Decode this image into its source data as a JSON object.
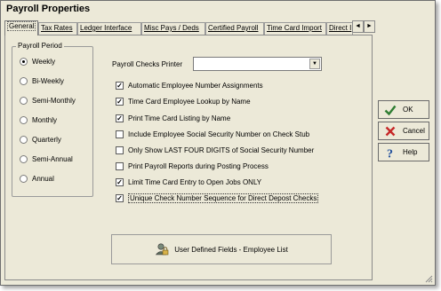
{
  "window": {
    "title": "Payroll Properties"
  },
  "tabs": [
    {
      "label": "General",
      "active": true
    },
    {
      "label": "Tax Rates",
      "active": false
    },
    {
      "label": "Ledger Interface",
      "active": false
    },
    {
      "label": "Misc Pays / Deds",
      "active": false
    },
    {
      "label": "Certified Payroll",
      "active": false
    },
    {
      "label": "Time Card Import",
      "active": false
    },
    {
      "label": "Direct I",
      "active": false
    }
  ],
  "tab_scroll": {
    "left": "◄",
    "right": "►"
  },
  "payroll_period": {
    "legend": "Payroll Period",
    "options": [
      {
        "label": "Weekly",
        "selected": true
      },
      {
        "label": "Bi-Weekly",
        "selected": false
      },
      {
        "label": "Semi-Monthly",
        "selected": false
      },
      {
        "label": "Monthly",
        "selected": false
      },
      {
        "label": "Quarterly",
        "selected": false
      },
      {
        "label": "Semi-Annual",
        "selected": false
      },
      {
        "label": "Annual",
        "selected": false
      }
    ]
  },
  "printer": {
    "label": "Payroll Checks Printer",
    "value": ""
  },
  "options": [
    {
      "label": "Automatic Employee Number Assignments",
      "checked": true
    },
    {
      "label": "Time Card Employee Lookup by Name",
      "checked": true
    },
    {
      "label": "Print Time Card Listing by Name",
      "checked": true
    },
    {
      "label": "Include Employee Social Security Number on Check Stub",
      "checked": false
    },
    {
      "label": "Only Show LAST FOUR DIGITS of Social Security Number",
      "checked": false
    },
    {
      "label": "Print Payroll Reports during Posting Process",
      "checked": false
    },
    {
      "label": "Limit Time Card Entry to Open Jobs ONLY",
      "checked": true
    },
    {
      "label": "Unique Check Number Sequence for Direct Depost Checks",
      "checked": true
    }
  ],
  "udf_button": {
    "label": "User Defined Fields - Employee List"
  },
  "buttons": {
    "ok": "OK",
    "cancel": "Cancel",
    "help": "Help"
  },
  "colors": {
    "ok_green": "#2e7d32",
    "cancel_red": "#c62828",
    "help_blue": "#1f4e9c",
    "window_bg": "#ece9d8"
  }
}
